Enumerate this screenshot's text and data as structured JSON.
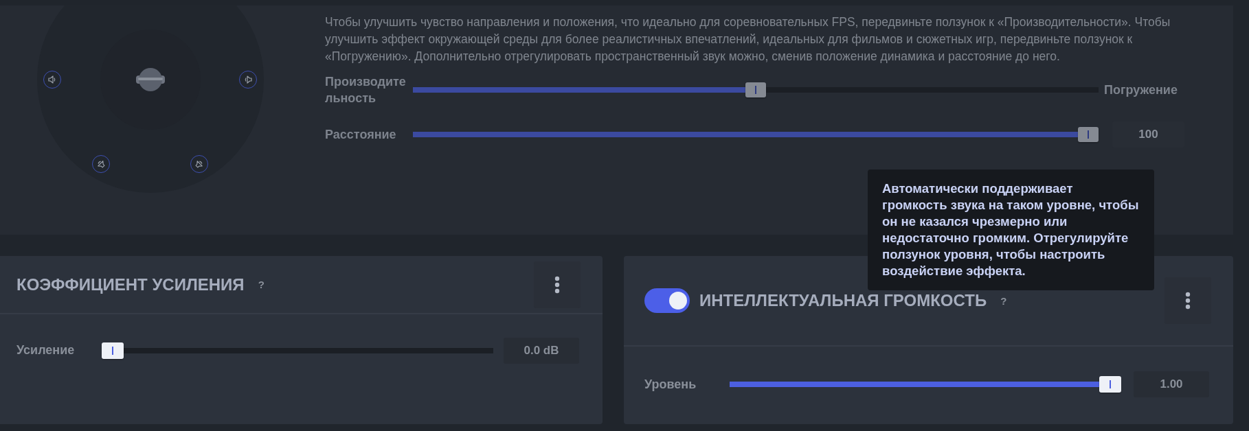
{
  "spatial": {
    "description": "Чтобы улучшить чувство направления и положения, что идеально для соревновательных FPS, передвиньте ползунок к «Производительности». Чтобы улучшить эффект окружающей среды для более реалистичных впечатлений, идеальных для фильмов и сюжетных игр, передвиньте ползунок к «Погружению». Дополнительно отрегулировать пространственный звук можно, сменив положение динамика и расстояние до него.",
    "sliders": [
      {
        "kind": "balance",
        "label": "Производительность",
        "right_label": "Погружение",
        "level": 0.5
      },
      {
        "kind": "value",
        "label": "Расстояние",
        "level": 1,
        "value": "100"
      }
    ]
  },
  "cards": [
    {
      "title": "КОЭФФИЦИЕНТ УСИЛЕНИЯ",
      "help": "?",
      "slider": {
        "label": "Усиление",
        "level": 0,
        "value": "0.0 dB"
      }
    },
    {
      "on": true,
      "title": "ИНТЕЛЛЕКТУАЛЬНАЯ ГРОМКОСТЬ",
      "help": "?",
      "slider": {
        "label": "Уровень",
        "level": 1,
        "value": "1.00"
      }
    }
  ],
  "tooltip": {
    "text": "Автоматически поддерживает громкость звука на таком уровне, чтобы он не казался чрезмерно или недостаточно громким. Отрегулируйте ползунок уровня, чтобы настроить воздействие эффекта."
  }
}
